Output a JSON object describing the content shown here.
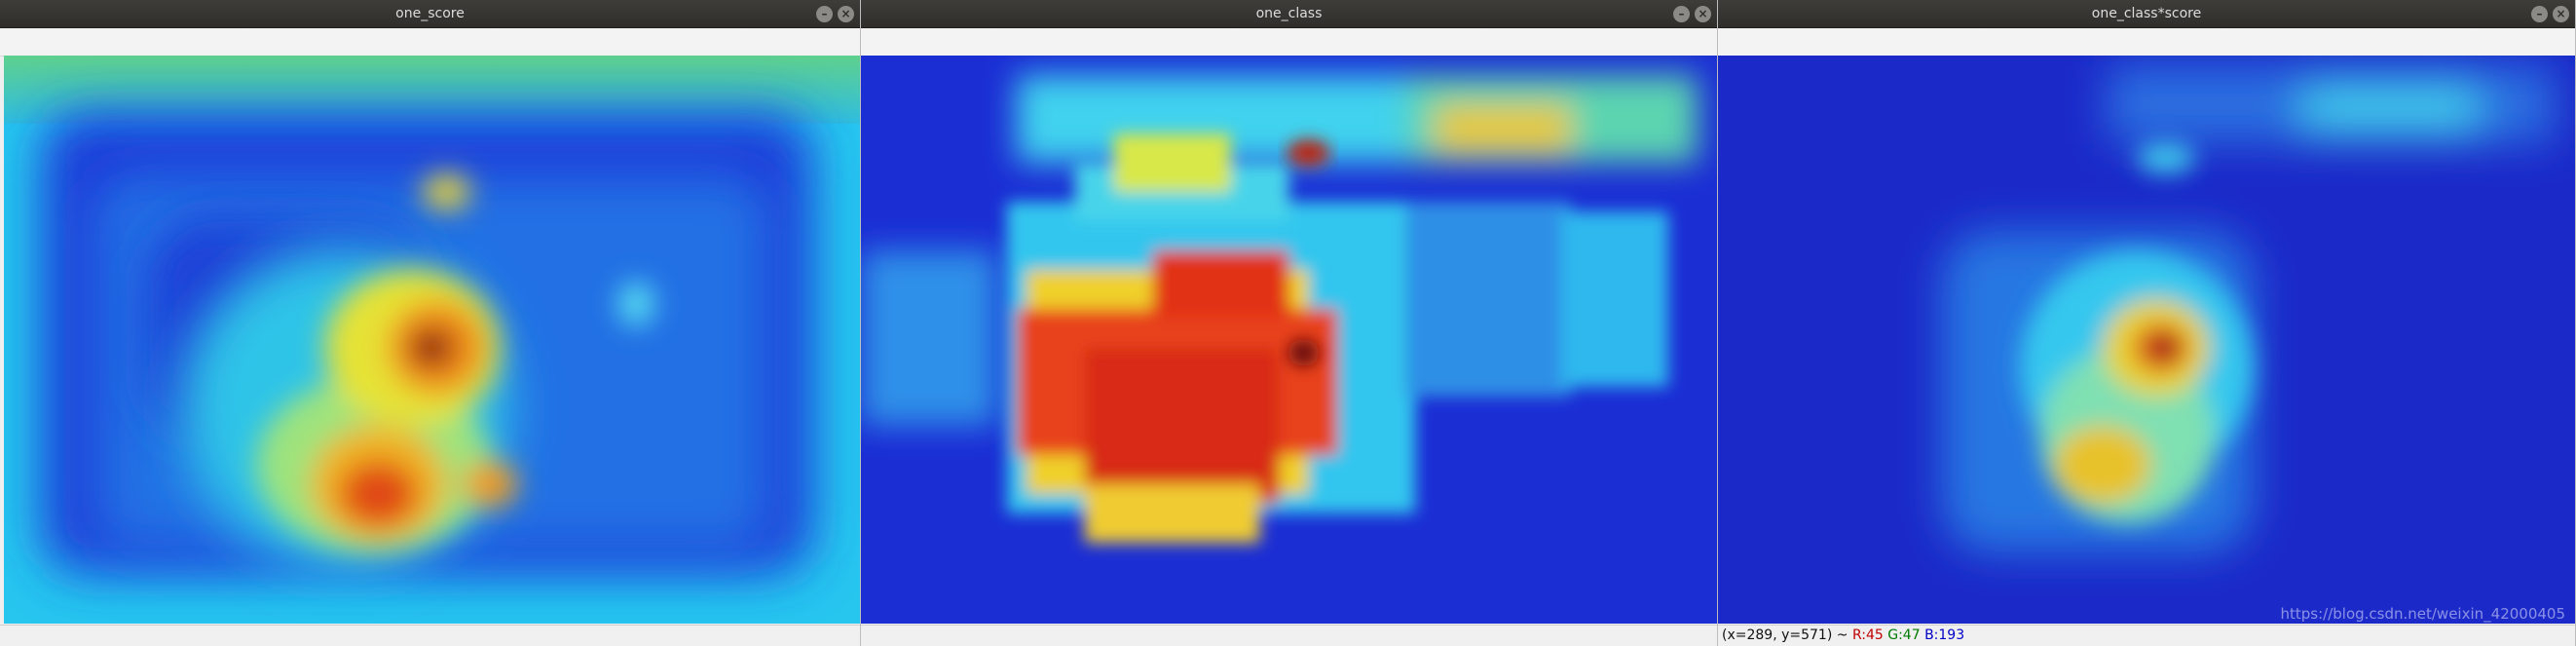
{
  "windows": [
    {
      "title": "one_score"
    },
    {
      "title": "one_class"
    },
    {
      "title": "one_class*score"
    }
  ],
  "window_controls": {
    "minimize_glyph": "–",
    "close_glyph": "×"
  },
  "status": {
    "coords": "(x=289, y=571) ~",
    "r": "R:45",
    "g": "G:47",
    "b": "B:193"
  },
  "watermark": "https://blog.csdn.net/weixin_42000405",
  "colors": {
    "heat_low": "#1616d8",
    "heat_mid": "#33d9f0",
    "heat_high": "#d61f14",
    "titlebar": "#3a3935"
  }
}
